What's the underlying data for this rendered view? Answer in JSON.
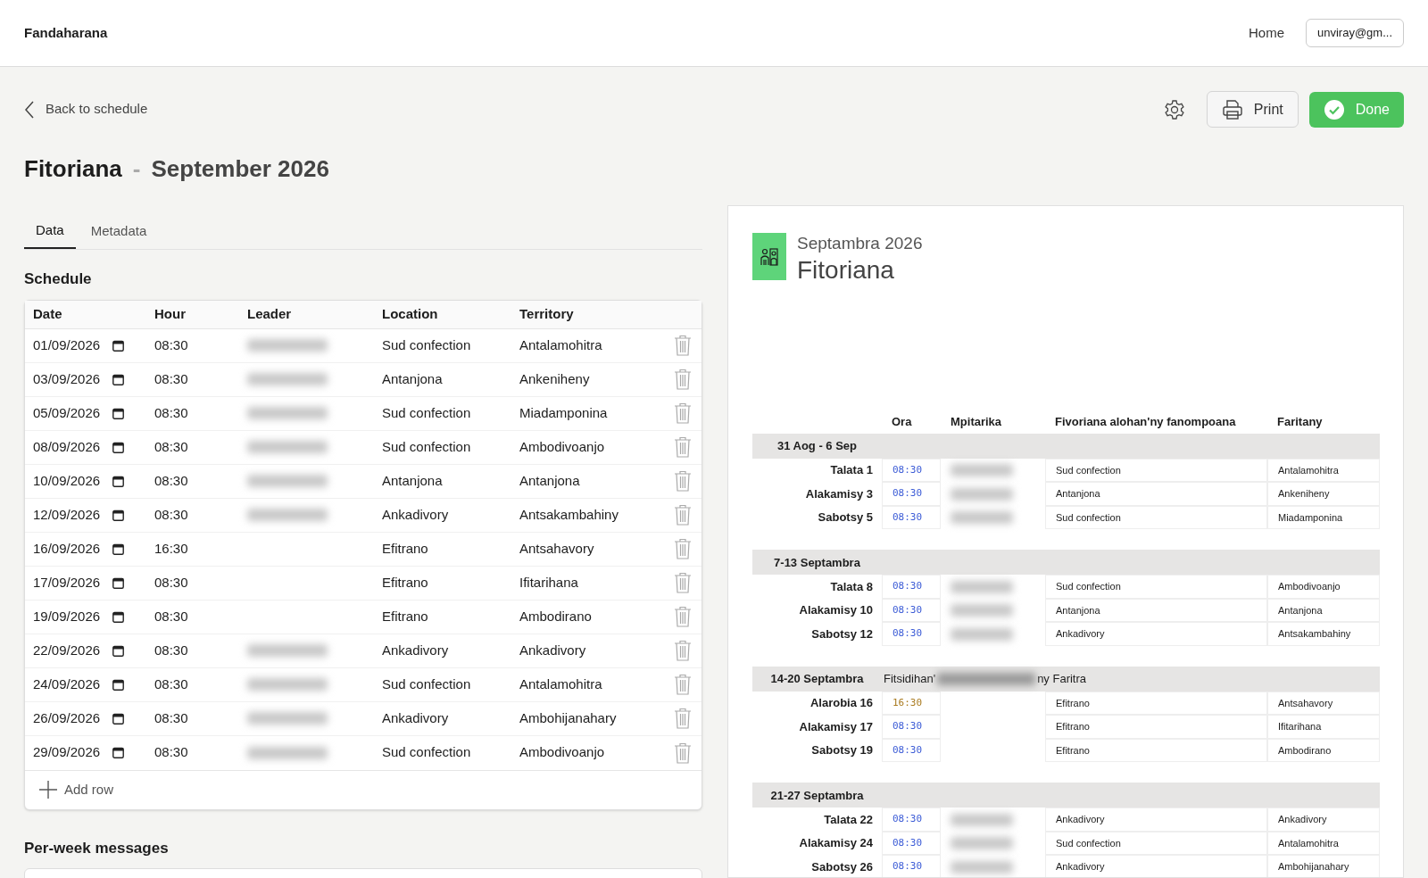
{
  "app": {
    "title": "Fandaharana",
    "nav": "Home",
    "account": "unviray@gm..."
  },
  "toolbar": {
    "back": "Back to schedule",
    "print": "Print",
    "done": "Done"
  },
  "heading": {
    "title": "Fitoriana",
    "separator": "-",
    "subtitle": "September 2026"
  },
  "tabs": [
    {
      "label": "Data",
      "selected": true
    },
    {
      "label": "Metadata",
      "selected": false
    }
  ],
  "schedule": {
    "title": "Schedule",
    "columns": [
      "Date",
      "Hour",
      "Leader",
      "Location",
      "Territory"
    ],
    "rows": [
      {
        "date": "01/09/2026",
        "hour": "08:30",
        "leader_redacted": true,
        "location": "Sud confection",
        "territory": "Antalamohitra"
      },
      {
        "date": "03/09/2026",
        "hour": "08:30",
        "leader_redacted": true,
        "location": "Antanjona",
        "territory": "Ankeniheny"
      },
      {
        "date": "05/09/2026",
        "hour": "08:30",
        "leader_redacted": true,
        "location": "Sud confection",
        "territory": "Miadamponina"
      },
      {
        "date": "08/09/2026",
        "hour": "08:30",
        "leader_redacted": true,
        "location": "Sud confection",
        "territory": "Ambodivoanjo"
      },
      {
        "date": "10/09/2026",
        "hour": "08:30",
        "leader_redacted": true,
        "location": "Antanjona",
        "territory": "Antanjona"
      },
      {
        "date": "12/09/2026",
        "hour": "08:30",
        "leader_redacted": true,
        "location": "Ankadivory",
        "territory": "Antsakambahiny"
      },
      {
        "date": "16/09/2026",
        "hour": "16:30",
        "leader_redacted": false,
        "location": "Efitrano",
        "territory": "Antsahavory"
      },
      {
        "date": "17/09/2026",
        "hour": "08:30",
        "leader_redacted": false,
        "location": "Efitrano",
        "territory": "Ifitarihana"
      },
      {
        "date": "19/09/2026",
        "hour": "08:30",
        "leader_redacted": false,
        "location": "Efitrano",
        "territory": "Ambodirano"
      },
      {
        "date": "22/09/2026",
        "hour": "08:30",
        "leader_redacted": true,
        "location": "Ankadivory",
        "territory": "Ankadivory"
      },
      {
        "date": "24/09/2026",
        "hour": "08:30",
        "leader_redacted": true,
        "location": "Sud confection",
        "territory": "Antalamohitra"
      },
      {
        "date": "26/09/2026",
        "hour": "08:30",
        "leader_redacted": true,
        "location": "Ankadivory",
        "territory": "Ambohijanahary"
      },
      {
        "date": "29/09/2026",
        "hour": "08:30",
        "leader_redacted": true,
        "location": "Sud confection",
        "territory": "Ambodivoanjo"
      }
    ],
    "add_row": "Add row"
  },
  "messages": {
    "title": "Per-week messages"
  },
  "preview": {
    "month": "Septambra 2026",
    "title": "Fitoriana",
    "columns": [
      "Ora",
      "Mpitarika",
      "Fivoriana alohan'ny fanompoana",
      "Faritany"
    ],
    "weeks": [
      {
        "label": "31 Aog - 6 Sep",
        "rows": [
          {
            "day": "Talata 1",
            "time": "08:30",
            "color": "#3b5bd6",
            "leader_redacted": true,
            "location": "Sud confection",
            "territory": "Antalamohitra"
          },
          {
            "day": "Alakamisy 3",
            "time": "08:30",
            "color": "#3b5bd6",
            "leader_redacted": true,
            "location": "Antanjona",
            "territory": "Ankeniheny"
          },
          {
            "day": "Sabotsy 5",
            "time": "08:30",
            "color": "#3b5bd6",
            "leader_redacted": true,
            "location": "Sud confection",
            "territory": "Miadamponina"
          }
        ]
      },
      {
        "label": "7-13 Septambra",
        "rows": [
          {
            "day": "Talata 8",
            "time": "08:30",
            "color": "#3b5bd6",
            "leader_redacted": true,
            "location": "Sud confection",
            "territory": "Ambodivoanjo"
          },
          {
            "day": "Alakamisy 10",
            "time": "08:30",
            "color": "#3b5bd6",
            "leader_redacted": true,
            "location": "Antanjona",
            "territory": "Antanjona"
          },
          {
            "day": "Sabotsy 12",
            "time": "08:30",
            "color": "#3b5bd6",
            "leader_redacted": true,
            "location": "Ankadivory",
            "territory": "Antsakambahiny"
          }
        ]
      },
      {
        "label": "14-20 Septambra",
        "note_start": "Fitsidihan'",
        "note_end": "ny Faritra",
        "rows": [
          {
            "day": "Alarobia 16",
            "time": "16:30",
            "color": "#a97a1f",
            "leader_redacted": false,
            "location": "Efitrano",
            "territory": "Antsahavory"
          },
          {
            "day": "Alakamisy 17",
            "time": "08:30",
            "color": "#3b5bd6",
            "leader_redacted": false,
            "location": "Efitrano",
            "territory": "Ifitarihana"
          },
          {
            "day": "Sabotsy 19",
            "time": "08:30",
            "color": "#3b5bd6",
            "leader_redacted": false,
            "location": "Efitrano",
            "territory": "Ambodirano"
          }
        ]
      },
      {
        "label": "21-27 Septambra",
        "rows": [
          {
            "day": "Talata 22",
            "time": "08:30",
            "color": "#3b5bd6",
            "leader_redacted": true,
            "location": "Ankadivory",
            "territory": "Ankadivory"
          },
          {
            "day": "Alakamisy 24",
            "time": "08:30",
            "color": "#3b5bd6",
            "leader_redacted": true,
            "location": "Sud confection",
            "territory": "Antalamohitra"
          },
          {
            "day": "Sabotsy 26",
            "time": "08:30",
            "color": "#3b5bd6",
            "leader_redacted": true,
            "location": "Ankadivory",
            "territory": "Ambohijanahary"
          }
        ]
      }
    ]
  }
}
